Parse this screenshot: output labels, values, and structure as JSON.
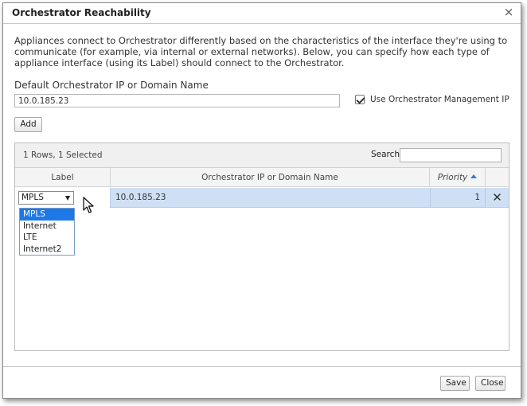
{
  "dialog": {
    "title": "Orchestrator Reachability",
    "close_icon": "×"
  },
  "description": "Appliances connect to Orchestrator differently based on the characteristics of the interface they're using to communicate (for example, via internal or external networks). Below, you can specify how each type of appliance interface (using its Label) should connect to the Orchestrator.",
  "default_ip": {
    "label": "Default Orchestrator IP or Domain Name",
    "value": "10.0.185.23"
  },
  "use_mgmt_ip": {
    "label": "Use Orchestrator Management IP",
    "checked": true
  },
  "add_button": "Add",
  "grid": {
    "rows_info": "1 Rows, 1 Selected",
    "search_label": "Search",
    "search_value": "",
    "columns": {
      "label": "Label",
      "ip": "Orchestrator IP or Domain Name",
      "priority": "Priority"
    },
    "rows": [
      {
        "label": "MPLS",
        "ip": "10.0.185.23",
        "priority": "1",
        "delete_icon": "✕"
      }
    ],
    "dropdown_options": [
      "MPLS",
      "Internet",
      "LTE",
      "Internet2"
    ],
    "dropdown_selected": "MPLS"
  },
  "footer": {
    "save": "Save",
    "close": "Close"
  },
  "colors": {
    "selected_row": "#cfe0f4",
    "dropdown_highlight": "#1e78e6",
    "sort_arrow": "#3a7bd5"
  },
  "icons": {
    "close": "close-icon",
    "delete": "delete-x-icon",
    "sort": "sort-ascending-icon",
    "caret": "dropdown-caret-icon",
    "cursor": "mouse-pointer-icon",
    "checkbox": "checkbox-checked-icon"
  }
}
